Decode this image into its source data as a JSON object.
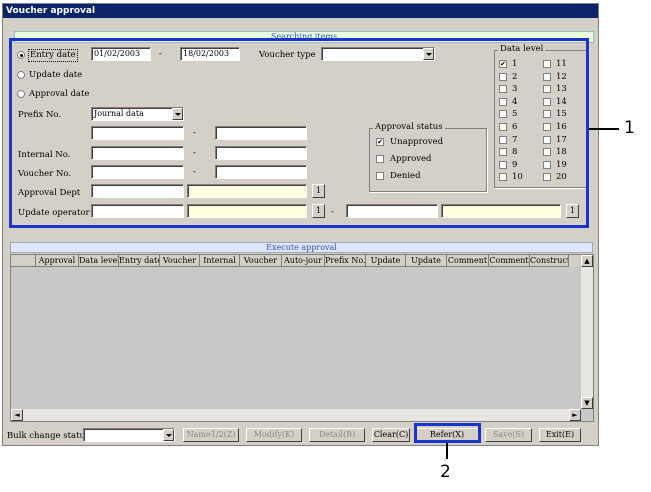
{
  "window": {
    "title": "Voucher approval"
  },
  "search": {
    "band_title": "Searching items",
    "entry_date_label": "Entry date",
    "update_date_label": "Update date",
    "approval_date_label": "Approval date",
    "date_from": "01/02/2003",
    "date_sep": "-",
    "date_to": "18/02/2003",
    "voucher_type_label": "Voucher type",
    "voucher_type_value": "",
    "prefix_label": "Prefix No.",
    "prefix_value": "Journal data",
    "internal_label": "Internal No.",
    "voucher_no_label": "Voucher No.",
    "approval_dept_label": "Approval Dept",
    "update_operator_label": "Update operator",
    "ref_button": "1"
  },
  "approval_status": {
    "title": "Approval status",
    "items": [
      {
        "label": "Unapproved",
        "checked": true
      },
      {
        "label": "Approved",
        "checked": false
      },
      {
        "label": "Denied",
        "checked": false
      }
    ]
  },
  "data_level": {
    "title": "Data level",
    "items": [
      "1",
      "2",
      "3",
      "4",
      "5",
      "6",
      "7",
      "8",
      "9",
      "10",
      "11",
      "12",
      "13",
      "14",
      "15",
      "16",
      "17",
      "18",
      "19",
      "20"
    ],
    "checked": [
      "1"
    ]
  },
  "execute": {
    "band_title": "Execute approval",
    "columns": [
      "Approval",
      "Data level",
      "Entry date",
      "Voucher",
      "Internal",
      "Voucher",
      "Auto-jour",
      "Prefix No.",
      "Update",
      "Update",
      "Comment",
      "Comment",
      "Constructi"
    ]
  },
  "bottom": {
    "bulk_label": "Bulk change status",
    "bulk_value": "",
    "buttons": [
      {
        "label": "Name1/2(Z)",
        "enabled": false
      },
      {
        "label": "Modify(K)",
        "enabled": false
      },
      {
        "label": "Detail(B)",
        "enabled": false
      },
      {
        "label": "Clear(C)",
        "enabled": true
      },
      {
        "label": "Refer(X)",
        "enabled": true
      },
      {
        "label": "Save(S)",
        "enabled": false
      },
      {
        "label": "Exit(E)",
        "enabled": true
      }
    ]
  },
  "callouts": {
    "one": "1",
    "two": "2"
  },
  "colors": {
    "highlight": "#1a33cc",
    "titlebar": "#0a246a",
    "yellow_field": "#ffffe0"
  }
}
